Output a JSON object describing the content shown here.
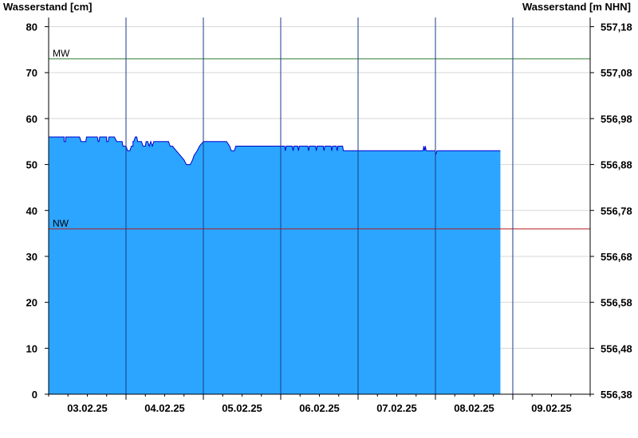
{
  "chart_data": {
    "type": "area",
    "ylabel_left": "Wasserstand [cm]",
    "ylabel_right": "Wasserstand [m NHN]",
    "ylim": [
      0,
      82
    ],
    "y_ticks_left": [
      "0",
      "10",
      "20",
      "30",
      "40",
      "50",
      "60",
      "70",
      "80"
    ],
    "y_ticks_right": [
      "556,38",
      "556,48",
      "556,58",
      "556,68",
      "556,78",
      "556,88",
      "556,98",
      "557,08",
      "557,18"
    ],
    "x_labels": [
      "03.02.25",
      "04.02.25",
      "05.02.25",
      "06.02.25",
      "07.02.25",
      "08.02.25",
      "09.02.25"
    ],
    "x_range_days": [
      2.5,
      9.5
    ],
    "day_boundaries": [
      3,
      4,
      5,
      6,
      7,
      8,
      9
    ],
    "grid": true,
    "reference_lines": [
      {
        "label": "MW",
        "value": 73,
        "color": "#2e7d32"
      },
      {
        "label": "NW",
        "value": 36,
        "color": "#b71c1c"
      }
    ],
    "fill_color": "#2ba5ff",
    "line_color": "#0000cc",
    "series": [
      {
        "points": [
          [
            2.5,
            56
          ],
          [
            2.7,
            56
          ],
          [
            2.7,
            55
          ],
          [
            2.72,
            55
          ],
          [
            2.72,
            56
          ],
          [
            2.9,
            56
          ],
          [
            2.92,
            55
          ],
          [
            2.98,
            55
          ],
          [
            2.99,
            56
          ],
          [
            3.13,
            56
          ],
          [
            3.14,
            55
          ],
          [
            3.15,
            55
          ],
          [
            3.16,
            56
          ],
          [
            3.25,
            56
          ],
          [
            3.25,
            55
          ],
          [
            3.27,
            55
          ],
          [
            3.28,
            56
          ],
          [
            3.35,
            56
          ],
          [
            3.38,
            55
          ],
          [
            3.45,
            55
          ],
          [
            3.46,
            54
          ],
          [
            3.5,
            54
          ],
          [
            3.52,
            53
          ],
          [
            3.55,
            53
          ],
          [
            3.57,
            54
          ],
          [
            3.59,
            54
          ],
          [
            3.59,
            55
          ],
          [
            3.6,
            55
          ],
          [
            3.62,
            56
          ],
          [
            3.64,
            56
          ],
          [
            3.65,
            55
          ],
          [
            3.7,
            55
          ],
          [
            3.72,
            54
          ],
          [
            3.75,
            54
          ],
          [
            3.76,
            55
          ],
          [
            3.78,
            55
          ],
          [
            3.8,
            54
          ],
          [
            3.82,
            55
          ],
          [
            3.84,
            54
          ],
          [
            3.86,
            55
          ],
          [
            3.9,
            55
          ],
          [
            3.95,
            55
          ],
          [
            4.05,
            55
          ],
          [
            4.07,
            54
          ],
          [
            4.1,
            54
          ],
          [
            4.15,
            53
          ],
          [
            4.2,
            52
          ],
          [
            4.25,
            51
          ],
          [
            4.28,
            50
          ],
          [
            4.33,
            50
          ],
          [
            4.36,
            51
          ],
          [
            4.38,
            52
          ],
          [
            4.42,
            53
          ],
          [
            4.45,
            54
          ],
          [
            4.5,
            55
          ],
          [
            4.8,
            55
          ],
          [
            4.84,
            54
          ],
          [
            4.86,
            53
          ],
          [
            4.9,
            53
          ],
          [
            4.92,
            54
          ],
          [
            5.5,
            54
          ],
          [
            5.55,
            54
          ],
          [
            5.56,
            53
          ],
          [
            5.57,
            54
          ],
          [
            5.65,
            54
          ],
          [
            5.66,
            53
          ],
          [
            5.67,
            54
          ],
          [
            5.72,
            54
          ],
          [
            5.73,
            53
          ],
          [
            5.74,
            54
          ],
          [
            5.85,
            54
          ],
          [
            5.86,
            53
          ],
          [
            5.87,
            54
          ],
          [
            5.95,
            54
          ],
          [
            5.96,
            53
          ],
          [
            5.97,
            54
          ],
          [
            6.05,
            54
          ],
          [
            6.06,
            53
          ],
          [
            6.07,
            54
          ],
          [
            6.15,
            54
          ],
          [
            6.16,
            53
          ],
          [
            6.17,
            54
          ],
          [
            6.22,
            54
          ],
          [
            6.23,
            53
          ],
          [
            6.24,
            54
          ],
          [
            6.3,
            54
          ],
          [
            6.31,
            53
          ],
          [
            6.5,
            53
          ],
          [
            7.34,
            53
          ],
          [
            7.35,
            54
          ],
          [
            7.36,
            53
          ],
          [
            7.37,
            54
          ],
          [
            7.38,
            53
          ],
          [
            7.5,
            53
          ],
          [
            7.5,
            52
          ],
          [
            7.52,
            53
          ],
          [
            8.34,
            53
          ]
        ]
      }
    ]
  }
}
